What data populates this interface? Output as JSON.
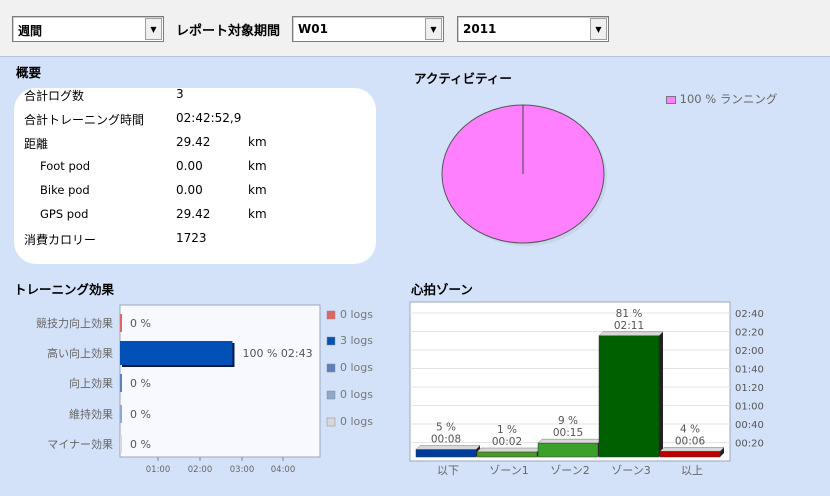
{
  "toolbar": {
    "period_type": "週間",
    "period_label": "レポート対象期間",
    "week": "W01",
    "year": "2011"
  },
  "summary": {
    "title": "概要",
    "rows": [
      {
        "label": "合計ログ数",
        "value": "3",
        "unit": ""
      },
      {
        "label": "合計トレーニング時間",
        "value": "02:42:52,9",
        "unit": ""
      },
      {
        "label": "距離",
        "value": "29.42",
        "unit": "km"
      },
      {
        "label": "Foot pod",
        "value": "0.00",
        "unit": "km"
      },
      {
        "label": "Bike pod",
        "value": "0.00",
        "unit": "km"
      },
      {
        "label": "GPS pod",
        "value": "29.42",
        "unit": "km"
      },
      {
        "label": "消費カロリー",
        "value": "1723",
        "unit": ""
      }
    ]
  },
  "activity": {
    "title": "アクティビティー",
    "legend": "100 % ランニング",
    "color": "#ff80ff"
  },
  "training": {
    "title": "トレーニング効果",
    "categories": [
      "競技力向上効果",
      "高い向上効果",
      "向上効果",
      "維持効果",
      "マイナー効果"
    ],
    "value_labels": [
      "0 %",
      "100 %   02:43",
      "0 %",
      "0 %",
      "0 %"
    ],
    "minutes": [
      0,
      163,
      0,
      0,
      0
    ],
    "colors": [
      "#e06666",
      "#0050b8",
      "#5b80c0",
      "#8ea8d0",
      "#d8d8d8"
    ],
    "legend": [
      "0  logs",
      "3  logs",
      "0  logs",
      "0  logs",
      "0  logs"
    ],
    "ticks": [
      "01:00",
      "02:00",
      "03:00",
      "04:00"
    ]
  },
  "hr": {
    "title": "心拍ゾーン",
    "categories": [
      "以下",
      "ゾーン1",
      "ゾーン2",
      "ゾーン3",
      "以上"
    ],
    "pct": [
      "5 %",
      "1 %",
      "9 %",
      "81 %",
      "4 %"
    ],
    "time": [
      "00:08",
      "00:02",
      "00:15",
      "02:11",
      "00:06"
    ],
    "minutes": [
      8,
      2,
      15,
      131,
      6
    ],
    "colors": [
      "#003c9e",
      "#4a9a2a",
      "#3aa02a",
      "#006000",
      "#c00000"
    ],
    "yticks": [
      "00:20",
      "00:40",
      "01:00",
      "01:20",
      "01:40",
      "02:00",
      "02:20",
      "02:40"
    ]
  },
  "chart_data": [
    {
      "type": "pie",
      "title": "アクティビティー",
      "categories": [
        "ランニング"
      ],
      "values": [
        100
      ]
    },
    {
      "type": "bar",
      "title": "トレーニング効果",
      "categories": [
        "競技力向上効果",
        "高い向上効果",
        "向上効果",
        "維持効果",
        "マイナー効果"
      ],
      "values": [
        "00:00",
        "02:43",
        "00:00",
        "00:00",
        "00:00"
      ],
      "percent": [
        0,
        100,
        0,
        0,
        0
      ],
      "logs": [
        0,
        3,
        0,
        0,
        0
      ],
      "xticks": [
        "01:00",
        "02:00",
        "03:00",
        "04:00"
      ]
    },
    {
      "type": "bar",
      "title": "心拍ゾーン",
      "categories": [
        "以下",
        "ゾーン1",
        "ゾーン2",
        "ゾーン3",
        "以上"
      ],
      "values": [
        "00:08",
        "00:02",
        "00:15",
        "02:11",
        "00:06"
      ],
      "percent": [
        5,
        1,
        9,
        81,
        4
      ],
      "yticks": [
        "00:20",
        "00:40",
        "01:00",
        "01:20",
        "01:40",
        "02:00",
        "02:20",
        "02:40"
      ]
    }
  ]
}
